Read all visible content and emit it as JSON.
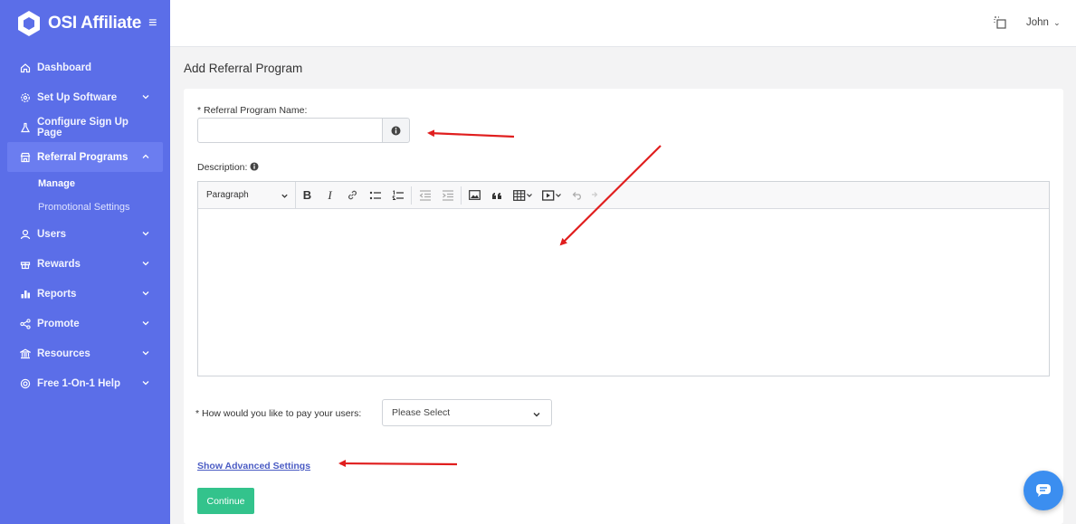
{
  "app": {
    "name": "OSI Affiliate"
  },
  "sidebar": {
    "items": [
      {
        "label": "Dashboard",
        "icon": "home-icon"
      },
      {
        "label": "Set Up Software",
        "icon": "gear-icon"
      },
      {
        "label": "Configure Sign Up Page",
        "icon": "flask-icon"
      },
      {
        "label": "Referral Programs",
        "icon": "store-icon"
      },
      {
        "label": "Users",
        "icon": "user-icon"
      },
      {
        "label": "Rewards",
        "icon": "gift-icon"
      },
      {
        "label": "Reports",
        "icon": "bar-chart-icon"
      },
      {
        "label": "Promote",
        "icon": "share-icon"
      },
      {
        "label": "Resources",
        "icon": "bank-icon"
      },
      {
        "label": "Free 1-On-1 Help",
        "icon": "lifebuoy-icon"
      }
    ],
    "sub_items": [
      {
        "label": "Manage"
      },
      {
        "label": "Promotional Settings"
      }
    ]
  },
  "topbar": {
    "user_name": "John"
  },
  "page": {
    "title": "Add Referral Program"
  },
  "form": {
    "program_name_label": "* Referral Program Name:",
    "program_name_value": "",
    "description_label": "Description:",
    "editor_block_format": "Paragraph",
    "pay_label": "* How would you like to pay your users:",
    "pay_select_value": "Please Select",
    "advanced_link": "Show Advanced Settings",
    "continue_label": "Continue"
  },
  "colors": {
    "sidebar_bg": "#5b6ee8",
    "continue_bg": "#33c38c",
    "link": "#4b5cc4",
    "chat_bg": "#3b8ef0",
    "annotation_arrow": "#e01e1e"
  }
}
